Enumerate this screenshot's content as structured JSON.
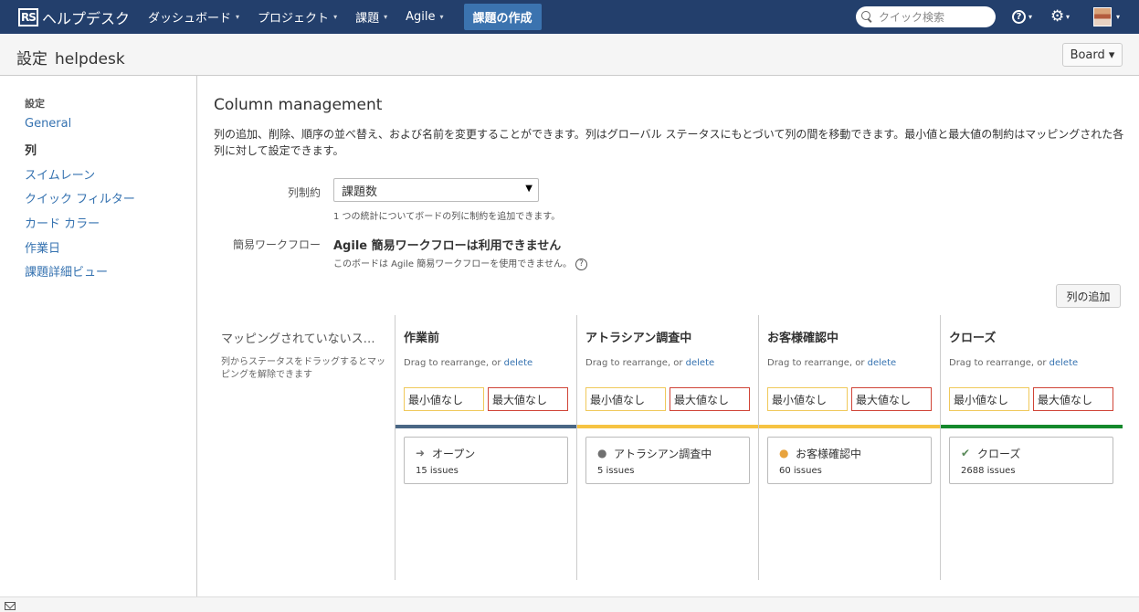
{
  "colors": {
    "nav_bg": "#233f6c",
    "create_bg": "#3b73af",
    "link": "#3572b0",
    "to_do": "#4a6785",
    "in_progress": "#f6c342",
    "done": "#14892c"
  },
  "nav": {
    "logo": "RS",
    "app_name": "ヘルプデスク",
    "items": [
      "ダッシュボード",
      "プロジェクト",
      "課題",
      "Agile"
    ],
    "create_label": "課題の作成",
    "search_placeholder": "クイック検索",
    "help_glyph": "?",
    "gear_glyph": "⚙",
    "caret": "▾"
  },
  "header": {
    "title": "設定",
    "board_name": "helpdesk",
    "board_button": "Board ▾"
  },
  "sidebar": {
    "heading": "設定",
    "items": [
      {
        "label": "General",
        "active": false
      },
      {
        "label": "列",
        "active": true
      },
      {
        "label": "スイムレーン",
        "active": false
      },
      {
        "label": "クイック フィルター",
        "active": false
      },
      {
        "label": "カード カラー",
        "active": false
      },
      {
        "label": "作業日",
        "active": false
      },
      {
        "label": "課題詳細ビュー",
        "active": false
      }
    ]
  },
  "main": {
    "title": "Column management",
    "description": "列の追加、削除、順序の並べ替え、および名前を変更することができます。列はグローバル ステータスにもとづいて列の間を移動できます。最小値と最大値の制約はマッピングされた各列に対して設定できます。",
    "constraint_label": "列制約",
    "constraint_value": "課題数",
    "constraint_help": "1 つの統計についてボードの列に制約を追加できます。",
    "simple_workflow_label": "簡易ワークフロー",
    "simple_workflow_value": "Agile 簡易ワークフローは利用できません",
    "simple_workflow_help": "このボードは Agile 簡易ワークフローを使用できません。",
    "add_column": "列の追加",
    "unmapped_title": "マッピングされていないステータス",
    "unmapped_desc": "列からステータスをドラッグするとマッピングを解除できます",
    "drag_text": "Drag to rearrange, or ",
    "delete_text": "delete",
    "min_label": "最小値なし",
    "max_label": "最大値なし"
  },
  "columns": [
    {
      "name": "作業前",
      "status": "オープン",
      "issues": "15 issues",
      "icon": "open-status-icon",
      "color": "#4a6785"
    },
    {
      "name": "アトラシアン調査中",
      "status": "アトラシアン調査中",
      "issues": "5 issues",
      "icon": "person-status-icon",
      "color": "#f6c342"
    },
    {
      "name": "お客様確認中",
      "status": "お客様確認中",
      "issues": "60 issues",
      "icon": "waiting-status-icon",
      "color": "#f6c342"
    },
    {
      "name": "クローズ",
      "status": "クローズ",
      "issues": "2688 issues",
      "icon": "closed-status-icon",
      "color": "#14892c"
    }
  ]
}
